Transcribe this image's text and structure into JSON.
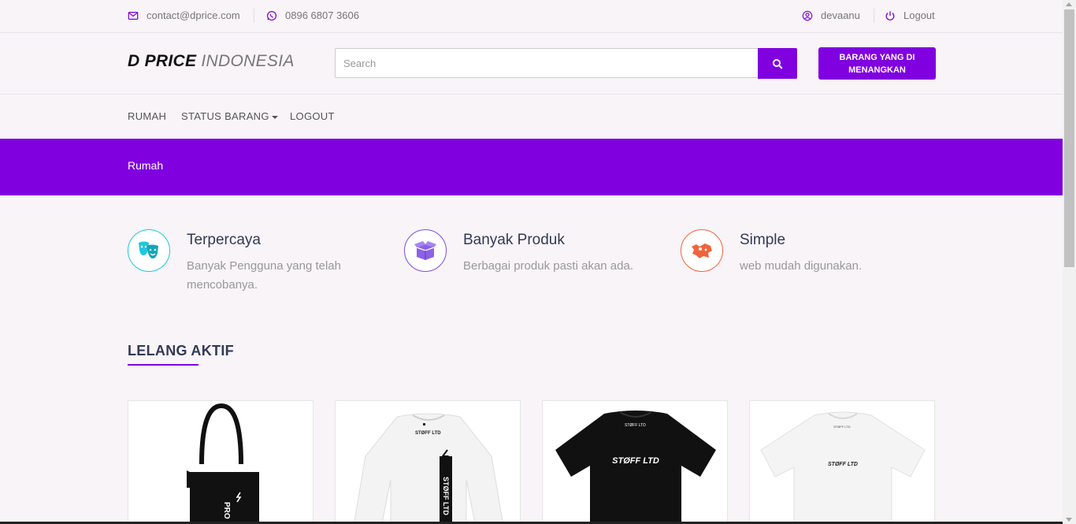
{
  "topbar": {
    "email": "contact@dprice.com",
    "phone": "0896 6807 3606",
    "user": "devaanu",
    "logout": "Logout"
  },
  "header": {
    "logo_bold": "D PRICE",
    "logo_light": "INDONESIA",
    "search_placeholder": "Search",
    "won_button": "BARANG YANG DI MENANGKAN"
  },
  "nav": {
    "items": [
      {
        "label": "RUMAH"
      },
      {
        "label": "STATUS BARANG"
      },
      {
        "label": "LOGOUT"
      }
    ]
  },
  "banner": {
    "breadcrumb": "Rumah"
  },
  "features": [
    {
      "title": "Terpercaya",
      "desc": "Banyak Pengguna yang telah mencobanya.",
      "icon": "masks-icon",
      "color": "#1fc8db"
    },
    {
      "title": "Banyak Produk",
      "desc": "Berbagai produk pasti akan ada.",
      "icon": "box-icon",
      "color": "#7b4fe0"
    },
    {
      "title": "Simple",
      "desc": "web mudah digunakan.",
      "icon": "map-icon",
      "color": "#f0643c"
    }
  ],
  "section": {
    "title": "LELANG AKTIF"
  },
  "products": [
    {
      "name": "tote-bag",
      "print_text": "PRO"
    },
    {
      "name": "white-longsleeve",
      "print_text": "STØFF LTD"
    },
    {
      "name": "black-tshirt",
      "print_text": "STØFF LTD"
    },
    {
      "name": "white-tshirt",
      "print_text": "STØFF LTD"
    }
  ],
  "colors": {
    "accent": "#8000e0",
    "background": "#f8f4f8"
  }
}
